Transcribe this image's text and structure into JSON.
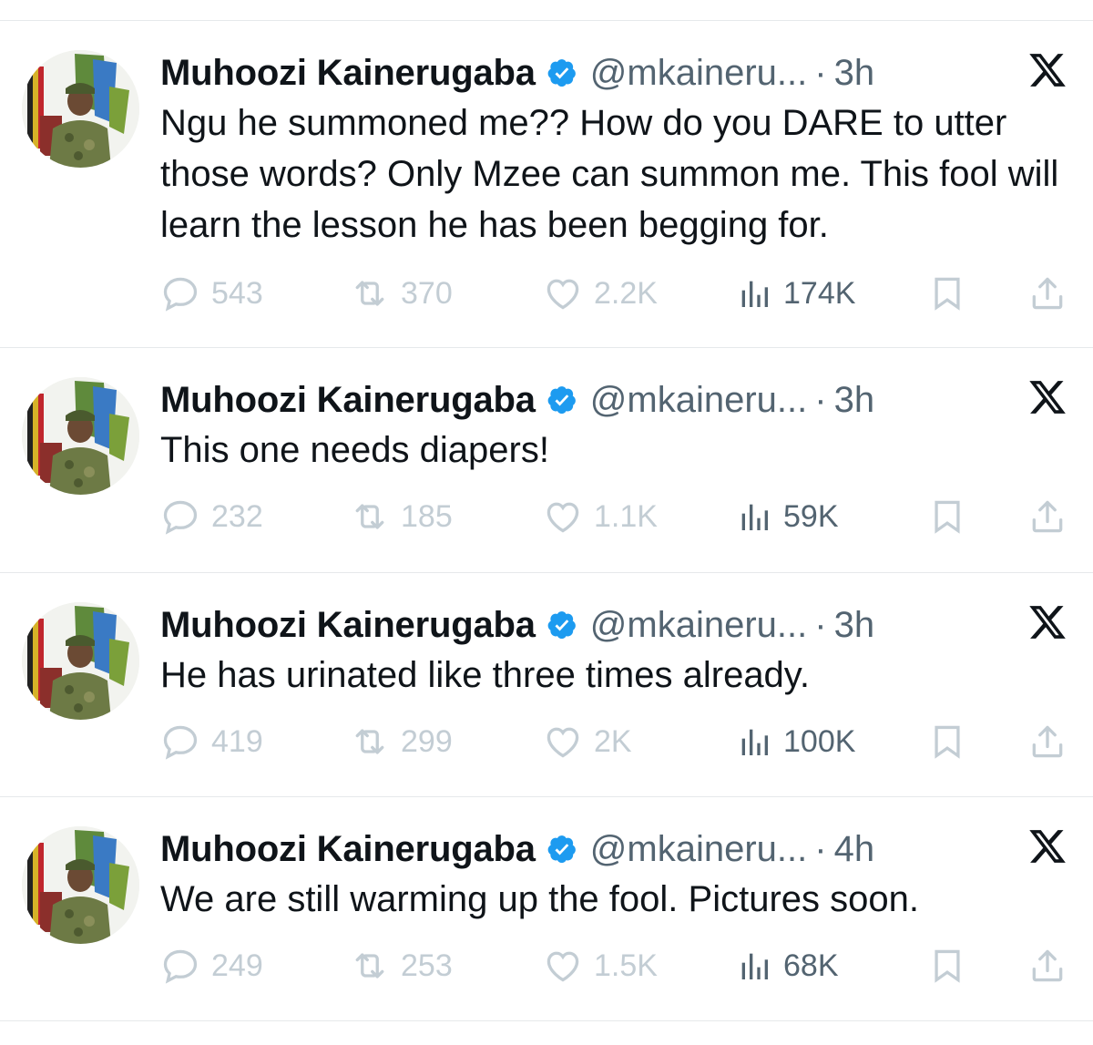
{
  "tweets": [
    {
      "author": {
        "name": "Muhoozi Kainerugaba",
        "handle": "@mkaineru...",
        "verified": true,
        "avatar": "avatar-military-officer"
      },
      "time": "3h",
      "text": "Ngu he summoned me?? How do you DARE to utter those words? Only Mzee can summon me. This fool will learn the lesson he has been begging for.",
      "stats": {
        "replies": "543",
        "reposts": "370",
        "likes": "2.2K",
        "views": "174K"
      }
    },
    {
      "author": {
        "name": "Muhoozi Kainerugaba",
        "handle": "@mkaineru...",
        "verified": true,
        "avatar": "avatar-military-officer"
      },
      "time": "3h",
      "text": "This one needs diapers!",
      "stats": {
        "replies": "232",
        "reposts": "185",
        "likes": "1.1K",
        "views": "59K"
      }
    },
    {
      "author": {
        "name": "Muhoozi Kainerugaba",
        "handle": "@mkaineru...",
        "verified": true,
        "avatar": "avatar-military-officer"
      },
      "time": "3h",
      "text": "He has urinated like three times already.",
      "stats": {
        "replies": "419",
        "reposts": "299",
        "likes": "2K",
        "views": "100K"
      }
    },
    {
      "author": {
        "name": "Muhoozi Kainerugaba",
        "handle": "@mkaineru...",
        "verified": true,
        "avatar": "avatar-military-officer"
      },
      "time": "4h",
      "text": "We are still warming up the fool. Pictures soon.",
      "stats": {
        "replies": "249",
        "reposts": "253",
        "likes": "1.5K",
        "views": "68K"
      }
    }
  ],
  "ui": {
    "separator": "·",
    "icons": {
      "reply": "reply-icon",
      "repost": "repost-icon",
      "like": "heart-icon",
      "views": "views-icon",
      "bookmark": "bookmark-icon",
      "share": "share-icon",
      "brand": "x-logo-icon",
      "verified": "verified-badge-icon"
    }
  },
  "colors": {
    "text": "#0f1419",
    "muted": "#536471",
    "faded_icon": "#c3cdd4",
    "verified": "#1d9bf0",
    "divider": "#e6e9eb"
  }
}
